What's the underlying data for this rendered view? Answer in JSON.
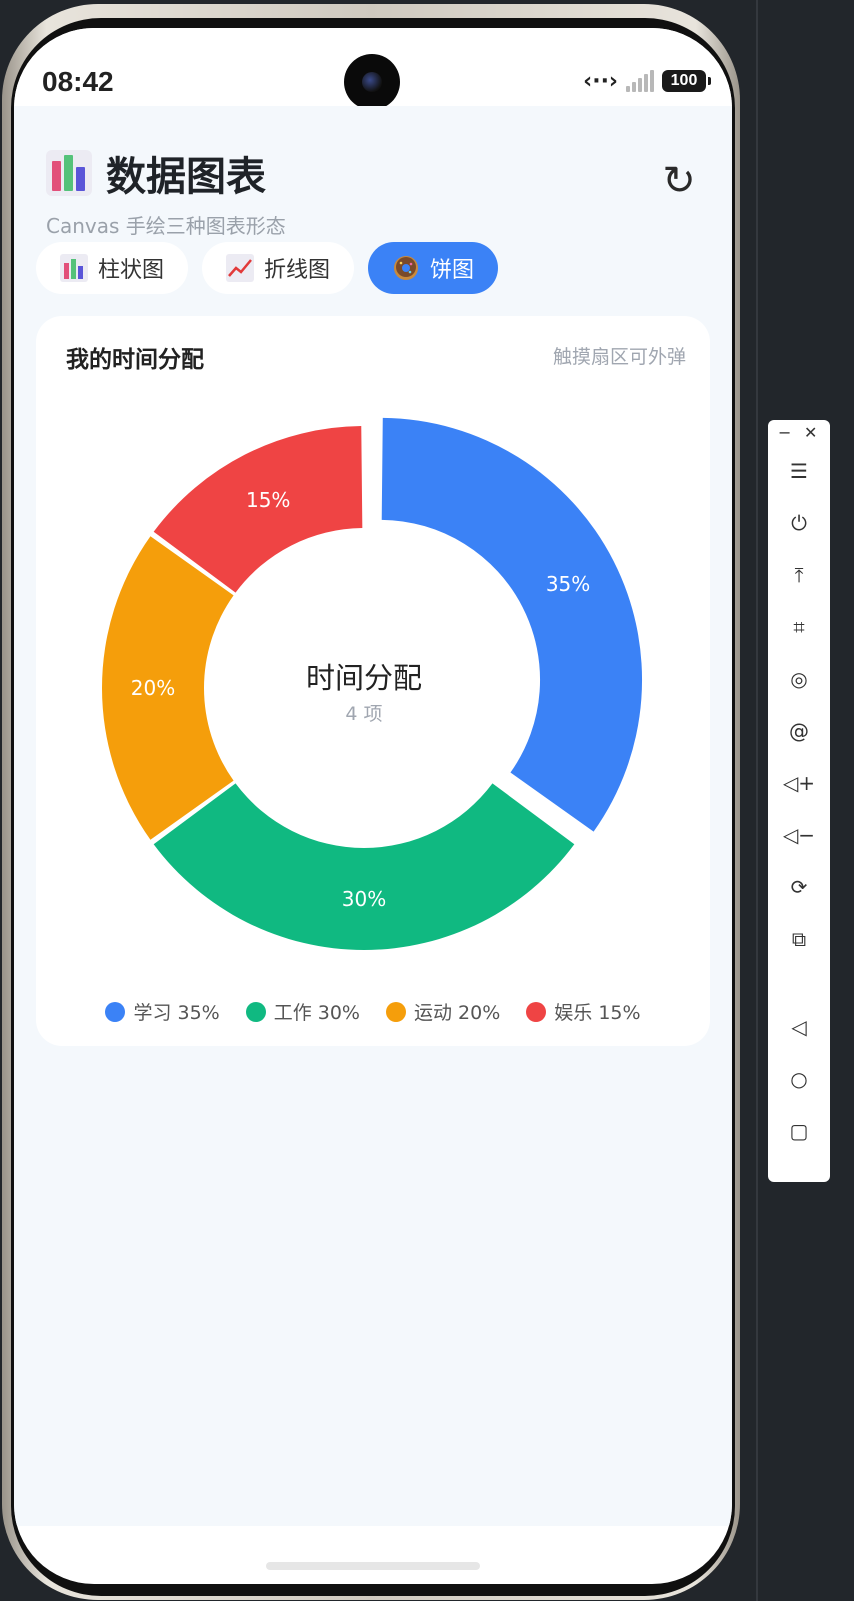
{
  "status_bar": {
    "time": "08:42",
    "battery": "100"
  },
  "app": {
    "title": "数据图表",
    "subtitle": "Canvas 手绘三种图表形态",
    "tabs": [
      {
        "label": "柱状图",
        "icon": "bar-chart-icon",
        "active": false
      },
      {
        "label": "折线图",
        "icon": "line-chart-icon",
        "active": false
      },
      {
        "label": "饼图",
        "icon": "donut-icon",
        "active": true
      }
    ]
  },
  "card": {
    "title": "我的时间分配",
    "hint": "触摸扇区可外弹",
    "center_title": "时间分配",
    "center_sub": "4 项"
  },
  "legend": [
    {
      "text": "学习 35%"
    },
    {
      "text": "工作 30%"
    },
    {
      "text": "运动 20%"
    },
    {
      "text": "娱乐 15%"
    }
  ],
  "chart_data": {
    "type": "pie",
    "categories": [
      "学习",
      "工作",
      "运动",
      "娱乐"
    ],
    "values": [
      35,
      30,
      20,
      15
    ],
    "labels": [
      "35%",
      "30%",
      "20%",
      "15%"
    ],
    "colors": [
      "#3b82f6",
      "#10b981",
      "#f59e0b",
      "#ef4444"
    ],
    "exploded_index": 0,
    "donut": true,
    "legend_position": "bottom"
  }
}
